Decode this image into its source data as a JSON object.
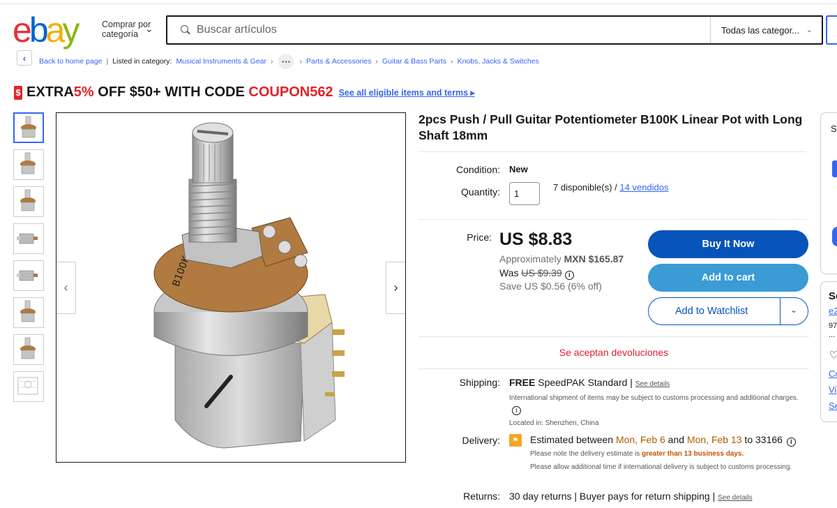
{
  "header": {
    "logo_letters": [
      "e",
      "b",
      "a",
      "y"
    ],
    "logo_colors": [
      "#e53238",
      "#0064d2",
      "#f5af02",
      "#86b817"
    ],
    "shop_by_label": "Comprar por categoría",
    "search_placeholder": "Buscar artículos",
    "category_select": "Todas las categor..."
  },
  "breadcrumb": {
    "back_label": "Back to home page",
    "listed_in": "Listed in category:",
    "items": [
      "Musical Instruments & Gear",
      "Parts & Accessories",
      "Guitar & Bass Parts",
      "Knobs, Jacks & Switches"
    ]
  },
  "promo": {
    "prefix": "EXTRA ",
    "percent": "5%",
    "middle": " OFF $50+ WITH CODE ",
    "code": "COUPON562",
    "link": "See all eligible items and terms ▸"
  },
  "gallery": {
    "thumb_count": 8,
    "active_index": 0
  },
  "product": {
    "title": "2pcs Push / Pull Guitar Potentiometer B100K Linear Pot with Long Shaft 18mm",
    "condition_label": "Condition:",
    "condition_value": "New",
    "quantity_label": "Quantity:",
    "quantity_value": "1",
    "available": "7 disponible(s) / ",
    "sold_link": "14 vendidos",
    "price_label": "Price:",
    "price": "US $8.83",
    "approx_prefix": "Approximately ",
    "approx_value": "MXN $165.87",
    "was_label": "Was ",
    "was_price": "US $9.39",
    "save": "Save US $0.56 (6% off)",
    "buy_now": "Buy It Now",
    "add_to_cart": "Add to cart",
    "add_to_watchlist": "Add to Watchlist",
    "returns_accepted": "Se aceptan devoluciones"
  },
  "shipping": {
    "label": "Shipping:",
    "free": "FREE",
    "method": " SpeedPAK Standard | ",
    "see_details": "See details",
    "intl_note": "International shipment of items may be subject to customs processing and additional charges.",
    "located": "Located in: Shenzhen, China"
  },
  "delivery": {
    "label": "Delivery:",
    "est_prefix": "Estimated between ",
    "date1": "Mon, Feb 6",
    "and": " and ",
    "date2": "Mon, Feb 13",
    "to": " to 33166",
    "note1_prefix": "Please note the delivery estimate is ",
    "note1_hl": "greater than 13 business days.",
    "note2": "Please allow additional time if international delivery is subject to customs processing."
  },
  "returns": {
    "label": "Returns:",
    "text": "30 day returns | Buyer pays for return shipping | ",
    "see_details": "See details"
  },
  "side": {
    "panel1_letter": "S",
    "panel2_letter": "Se",
    "panel2_link": "e2",
    "panel2_num": "97",
    "panel2_dots": "...",
    "panel2_link2": "Co",
    "panel2_link3": "Vi",
    "panel2_link4": "Se"
  }
}
